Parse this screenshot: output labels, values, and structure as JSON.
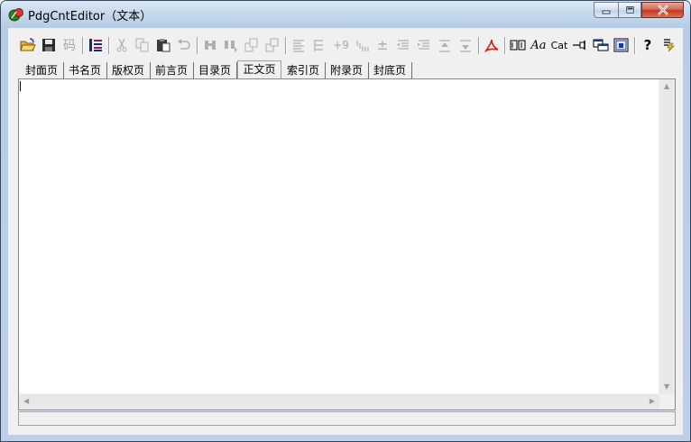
{
  "window": {
    "title": "PdgCntEditor（文本）",
    "controls": {
      "minimize": "minimize",
      "maximize": "maximize",
      "close": "close"
    }
  },
  "toolbar": {
    "items": [
      {
        "name": "open-folder-icon",
        "enabled": true
      },
      {
        "name": "save-icon",
        "enabled": true
      },
      {
        "name": "encoding-icon",
        "label": "码",
        "enabled": false
      },
      {
        "name": "outline-icon",
        "enabled": true
      },
      {
        "name": "cut-icon",
        "enabled": false
      },
      {
        "name": "copy-icon",
        "enabled": false
      },
      {
        "name": "paste-icon",
        "enabled": true
      },
      {
        "name": "undo-icon",
        "enabled": false
      },
      {
        "name": "find-icon",
        "enabled": false
      },
      {
        "name": "find-next-icon",
        "enabled": false
      },
      {
        "name": "replace-icon",
        "enabled": false
      },
      {
        "name": "replace-all-icon",
        "enabled": false
      },
      {
        "name": "align-left-icon",
        "enabled": false
      },
      {
        "name": "indent-icon",
        "enabled": false
      },
      {
        "name": "insert-page-icon",
        "label": "+9",
        "enabled": false
      },
      {
        "name": "page-number-icon",
        "enabled": false
      },
      {
        "name": "plus-minus-icon",
        "label": "±",
        "enabled": false
      },
      {
        "name": "outdent-icon",
        "enabled": false
      },
      {
        "name": "increase-indent-icon",
        "enabled": false
      },
      {
        "name": "move-up-icon",
        "enabled": false
      },
      {
        "name": "move-down-icon",
        "enabled": false
      },
      {
        "name": "pdf-icon",
        "enabled": true
      },
      {
        "name": "columns-icon",
        "enabled": true
      },
      {
        "name": "font-icon",
        "label": "Aa",
        "enabled": true
      },
      {
        "name": "catalog-icon",
        "label": "Cat",
        "enabled": true
      },
      {
        "name": "pin-icon",
        "enabled": true
      },
      {
        "name": "window-icon",
        "enabled": true
      },
      {
        "name": "export-icon",
        "enabled": true
      },
      {
        "name": "help-icon",
        "label": "?",
        "enabled": true
      },
      {
        "name": "run-icon",
        "enabled": true
      }
    ]
  },
  "tabs": [
    {
      "label": "封面页",
      "active": false
    },
    {
      "label": "书名页",
      "active": false
    },
    {
      "label": "版权页",
      "active": false
    },
    {
      "label": "前言页",
      "active": false
    },
    {
      "label": "目录页",
      "active": false
    },
    {
      "label": "正文页",
      "active": true
    },
    {
      "label": "索引页",
      "active": false
    },
    {
      "label": "附录页",
      "active": false
    },
    {
      "label": "封底页",
      "active": false
    }
  ],
  "editor": {
    "text": ""
  },
  "statusbar": {
    "text": ""
  }
}
